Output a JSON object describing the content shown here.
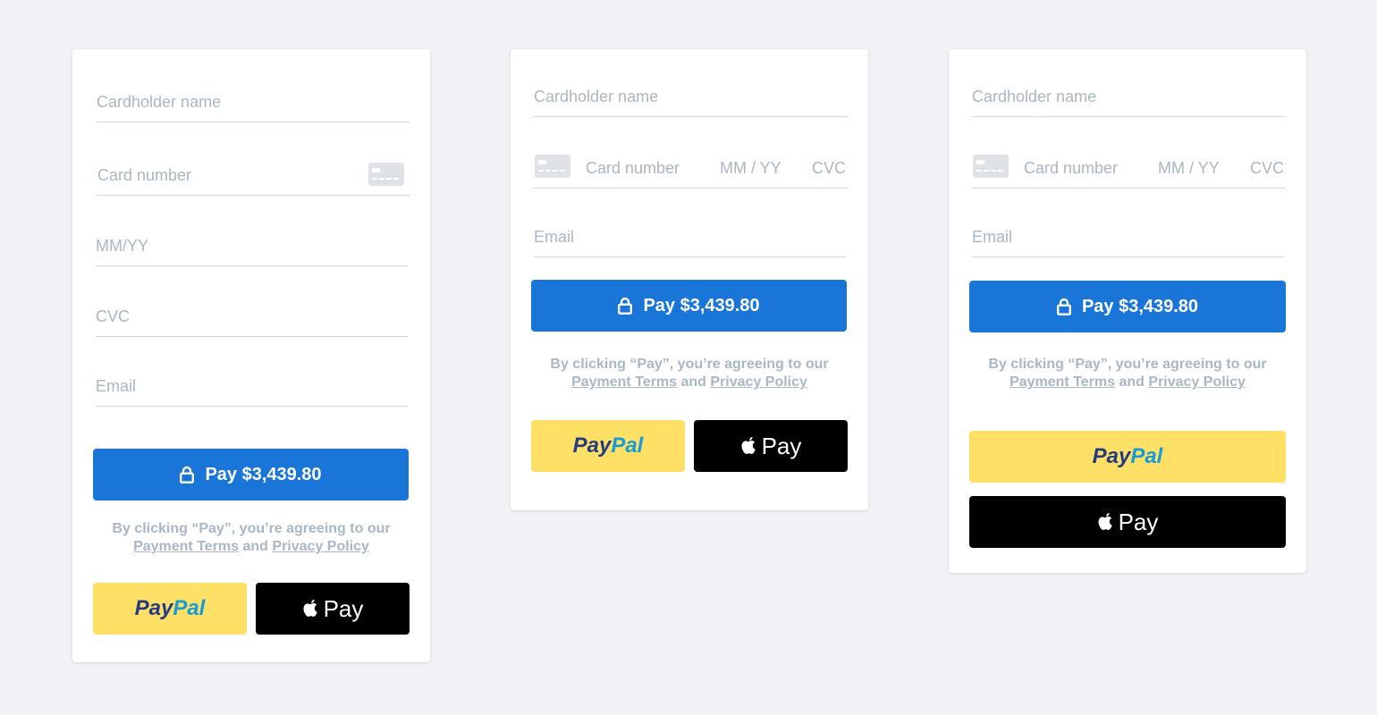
{
  "placeholders": {
    "cardholder_name": "Cardholder name",
    "card_number": "Card number",
    "expiry_slash": "MM/YY",
    "expiry_spaced": "MM / YY",
    "cvc": "CVC",
    "email": "Email"
  },
  "pay_button": {
    "label": "Pay $3,439.80"
  },
  "terms": {
    "prefix": "By clicking “Pay”, you’re agreeing to our",
    "payment_terms": "Payment Terms",
    "and": "and",
    "privacy_policy": "Privacy Policy"
  },
  "paypal": {
    "part1": "Pay",
    "part2": "Pal"
  },
  "apple_pay": {
    "label": "Pay"
  },
  "icons": {
    "card": "credit-card-icon",
    "lock": "lock-icon",
    "apple": "apple-logo-icon"
  },
  "colors": {
    "background": "#f2f2f6",
    "pay_button": "#1976d8",
    "paypal_button": "#fde065",
    "apple_button": "#000000",
    "placeholder": "#aab7c4",
    "paypal_dark": "#253b80",
    "paypal_light": "#179bd7"
  }
}
